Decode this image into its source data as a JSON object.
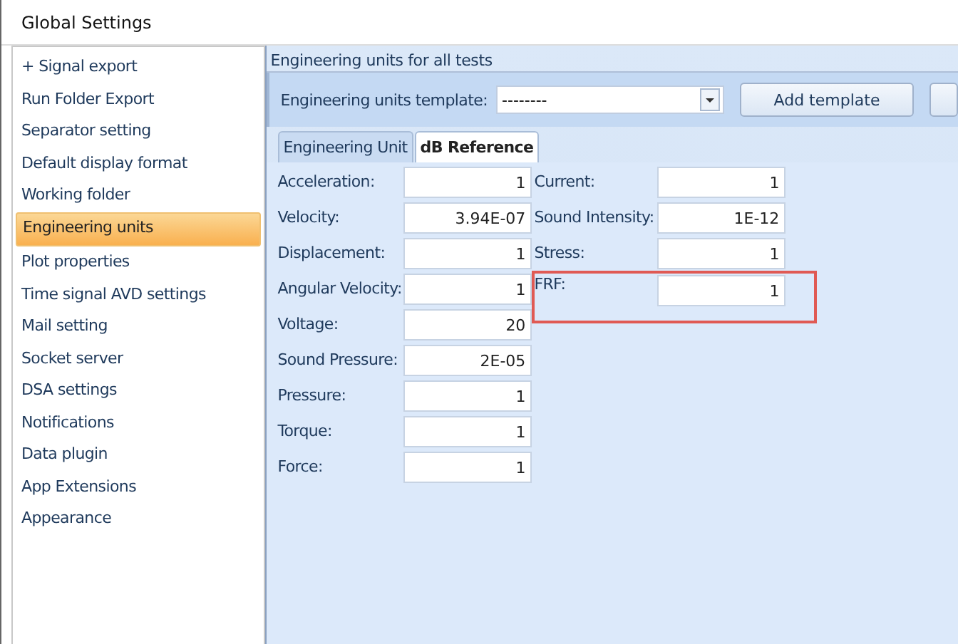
{
  "window": {
    "title": "Global Settings"
  },
  "sidebar": {
    "items": [
      {
        "label": "+ Signal export",
        "selected": false
      },
      {
        "label": "Run Folder Export",
        "selected": false
      },
      {
        "label": "Separator setting",
        "selected": false
      },
      {
        "label": "Default display format",
        "selected": false
      },
      {
        "label": "Working folder",
        "selected": false
      },
      {
        "label": "Engineering units",
        "selected": true
      },
      {
        "label": "Plot properties",
        "selected": false
      },
      {
        "label": "Time signal AVD settings",
        "selected": false
      },
      {
        "label": "Mail setting",
        "selected": false
      },
      {
        "label": "Socket server",
        "selected": false
      },
      {
        "label": "DSA settings",
        "selected": false
      },
      {
        "label": "Notifications",
        "selected": false
      },
      {
        "label": "Data plugin",
        "selected": false
      },
      {
        "label": "App Extensions",
        "selected": false
      },
      {
        "label": "Appearance",
        "selected": false
      }
    ]
  },
  "panel": {
    "title": "Engineering units for all tests",
    "template": {
      "label": "Engineering units template:",
      "value": "--------"
    },
    "add_button": "Add template",
    "tabs": [
      {
        "label": "Engineering Unit",
        "selected": false
      },
      {
        "label": "dB Reference",
        "selected": true
      }
    ],
    "left_fields": [
      {
        "label": "Acceleration:",
        "value": "1",
        "highlighted": false
      },
      {
        "label": "Velocity:",
        "value": "3.94E-07",
        "highlighted": false
      },
      {
        "label": "Displacement:",
        "value": "1",
        "highlighted": false
      },
      {
        "label": "Angular Velocity:",
        "value": "1",
        "highlighted": false
      },
      {
        "label": "Voltage:",
        "value": "20",
        "highlighted": false
      },
      {
        "label": "Sound Pressure:",
        "value": "2E-05",
        "highlighted": false
      },
      {
        "label": "Pressure:",
        "value": "1",
        "highlighted": false
      },
      {
        "label": "Torque:",
        "value": "1",
        "highlighted": false
      },
      {
        "label": "Force:",
        "value": "1",
        "highlighted": false
      }
    ],
    "right_fields": [
      {
        "label": "Current:",
        "value": "1",
        "highlighted": false
      },
      {
        "label": "Sound Intensity:",
        "value": "1E-12",
        "highlighted": false
      },
      {
        "label": "Stress:",
        "value": "1",
        "highlighted": false
      },
      {
        "label": "FRF:",
        "value": "1",
        "highlighted": true
      }
    ]
  }
}
